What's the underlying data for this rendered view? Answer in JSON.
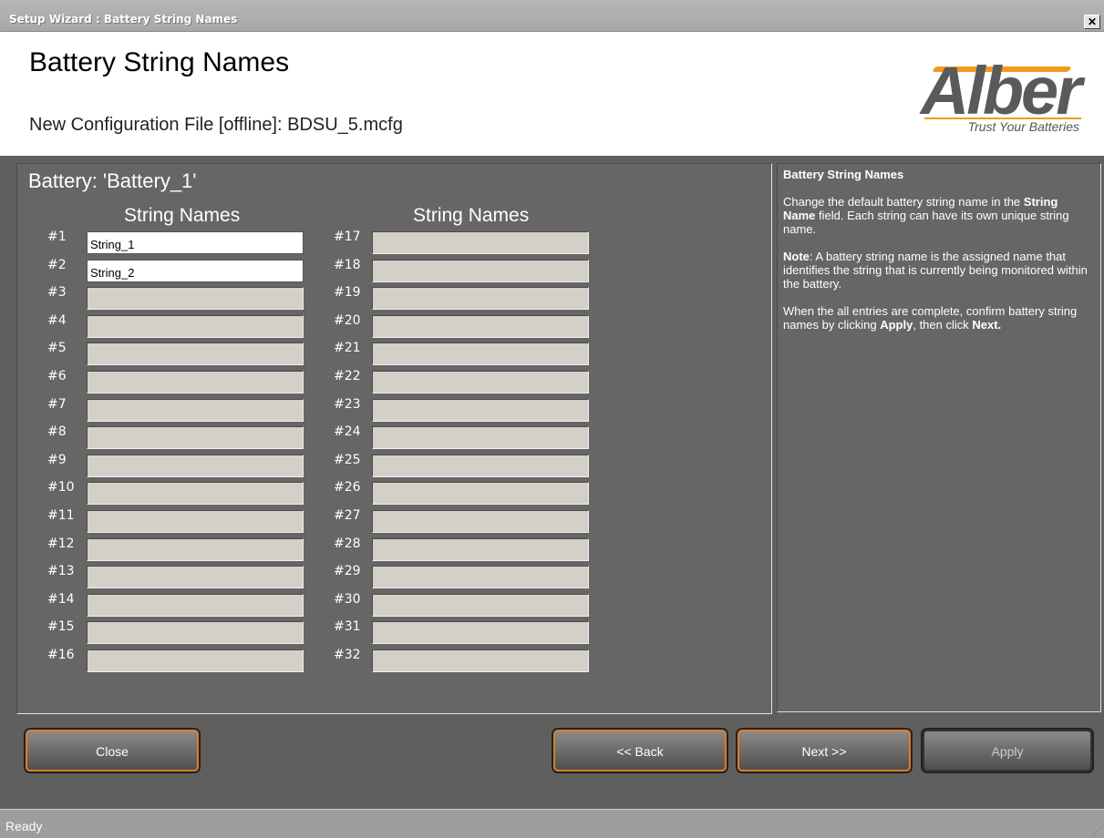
{
  "window": {
    "title": "Setup Wizard : Battery String Names",
    "close_glyph": "✕"
  },
  "header": {
    "title": "Battery String Names",
    "subtitle": "New Configuration File [offline]: BDSU_5.mcfg",
    "logo": {
      "wordmark": "Alber",
      "tagline": "Trust Your Batteries",
      "accent_color": "#f39a1e"
    }
  },
  "content": {
    "battery_title": "Battery: 'Battery_1'",
    "column_header": "String Names",
    "left_labels": [
      "#1",
      "#2",
      "#3",
      "#4",
      "#5",
      "#6",
      "#7",
      "#8",
      "#9",
      "#10",
      "#11",
      "#12",
      "#13",
      "#14",
      "#15",
      "#16"
    ],
    "right_labels": [
      "#17",
      "#18",
      "#19",
      "#20",
      "#21",
      "#22",
      "#23",
      "#24",
      "#25",
      "#26",
      "#27",
      "#28",
      "#29",
      "#30",
      "#31",
      "#32"
    ],
    "string_values": [
      "String_1",
      "String_2",
      "",
      "",
      "",
      "",
      "",
      "",
      "",
      "",
      "",
      "",
      "",
      "",
      "",
      "",
      "",
      "",
      "",
      "",
      "",
      "",
      "",
      "",
      "",
      "",
      "",
      "",
      "",
      "",
      "",
      ""
    ]
  },
  "help": {
    "title": "Battery String Names",
    "p1_before": "Change the default battery string name in the ",
    "p1_bold": "String Name",
    "p1_after": " field. Each string can have its own unique string name.",
    "p2_bold": "Note",
    "p2_after": ": A battery string name is the assigned name that identifies the string that is currently being monitored within the battery.",
    "p3_before": "When the all entries are complete, confirm battery string names by clicking ",
    "p3_bold1": "Apply",
    "p3_mid": ", then click ",
    "p3_bold2": "Next."
  },
  "buttons": {
    "close": "Close",
    "back": "<< Back",
    "next": "Next >>",
    "apply": "Apply"
  },
  "status": {
    "text": "Ready"
  }
}
